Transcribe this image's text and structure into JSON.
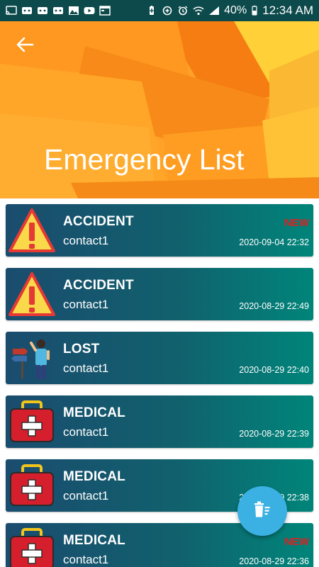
{
  "status_bar": {
    "left_icons": [
      "cast-icon",
      "game-icon",
      "game-icon",
      "game-icon",
      "gallery-icon",
      "youtube-icon",
      "calendar-icon"
    ],
    "right_icons": [
      "battery-saver-icon",
      "data-saver-icon",
      "alarm-icon",
      "wifi-icon",
      "signal-icon"
    ],
    "battery": "40%",
    "time": "12:34 AM"
  },
  "header": {
    "title": "Emergency List",
    "back_icon": "back-arrow-icon"
  },
  "items": [
    {
      "type": "ACCIDENT",
      "contact": "contact1",
      "date": "2020-09-04 22:32",
      "new_label": "NEW",
      "icon": "warning-icon"
    },
    {
      "type": "ACCIDENT",
      "contact": "contact1",
      "date": "2020-08-29 22:49",
      "new_label": "",
      "icon": "warning-icon"
    },
    {
      "type": "LOST",
      "contact": "contact1",
      "date": "2020-08-29 22:40",
      "new_label": "",
      "icon": "lost-person-icon"
    },
    {
      "type": "MEDICAL",
      "contact": "contact1",
      "date": "2020-08-29 22:39",
      "new_label": "",
      "icon": "medical-kit-icon"
    },
    {
      "type": "MEDICAL",
      "contact": "contact1",
      "date": "2020-08-29 22:38",
      "new_label": "",
      "icon": "medical-kit-icon"
    },
    {
      "type": "MEDICAL",
      "contact": "contact1",
      "date": "2020-08-29 22:36",
      "new_label": "NEW",
      "icon": "medical-kit-icon"
    }
  ],
  "fab": {
    "icon": "delete-list-icon"
  },
  "colors": {
    "status_bar": "#0d4a4c",
    "card_gradient_start": "#1a4c6e",
    "card_gradient_end": "#00857a",
    "new_badge": "#e21d1d",
    "fab": "#3bb1e3",
    "header_orange": "#ffa52a"
  }
}
